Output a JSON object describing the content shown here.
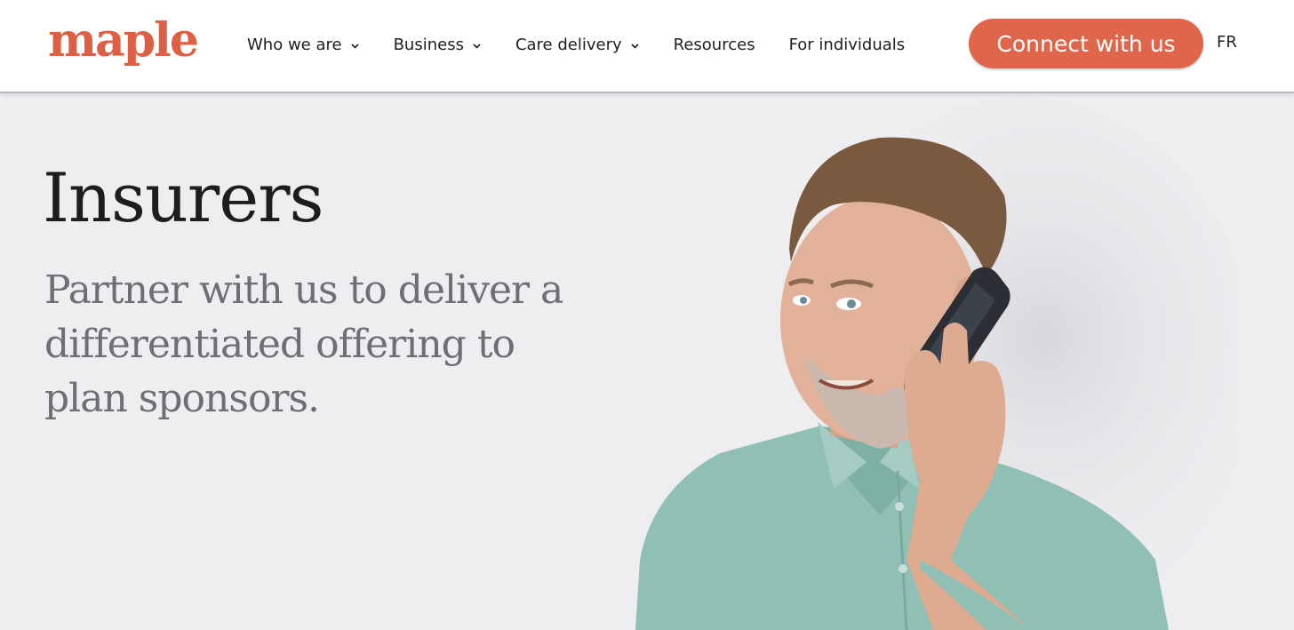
{
  "brand": {
    "logo_text": "maple",
    "accent_color": "#df5f45"
  },
  "nav": {
    "items": [
      {
        "label": "Who we are",
        "has_dropdown": true
      },
      {
        "label": "Business",
        "has_dropdown": true
      },
      {
        "label": "Care delivery",
        "has_dropdown": true
      },
      {
        "label": "Resources",
        "has_dropdown": false
      },
      {
        "label": "For individuals",
        "has_dropdown": false
      }
    ],
    "cta_label": "Connect with us",
    "language_toggle": "FR"
  },
  "hero": {
    "title": "Insurers",
    "subtitle": "Partner with us to deliver a differentiated offering to plan sponsors.",
    "image_icon": "man-on-phone-photo"
  }
}
